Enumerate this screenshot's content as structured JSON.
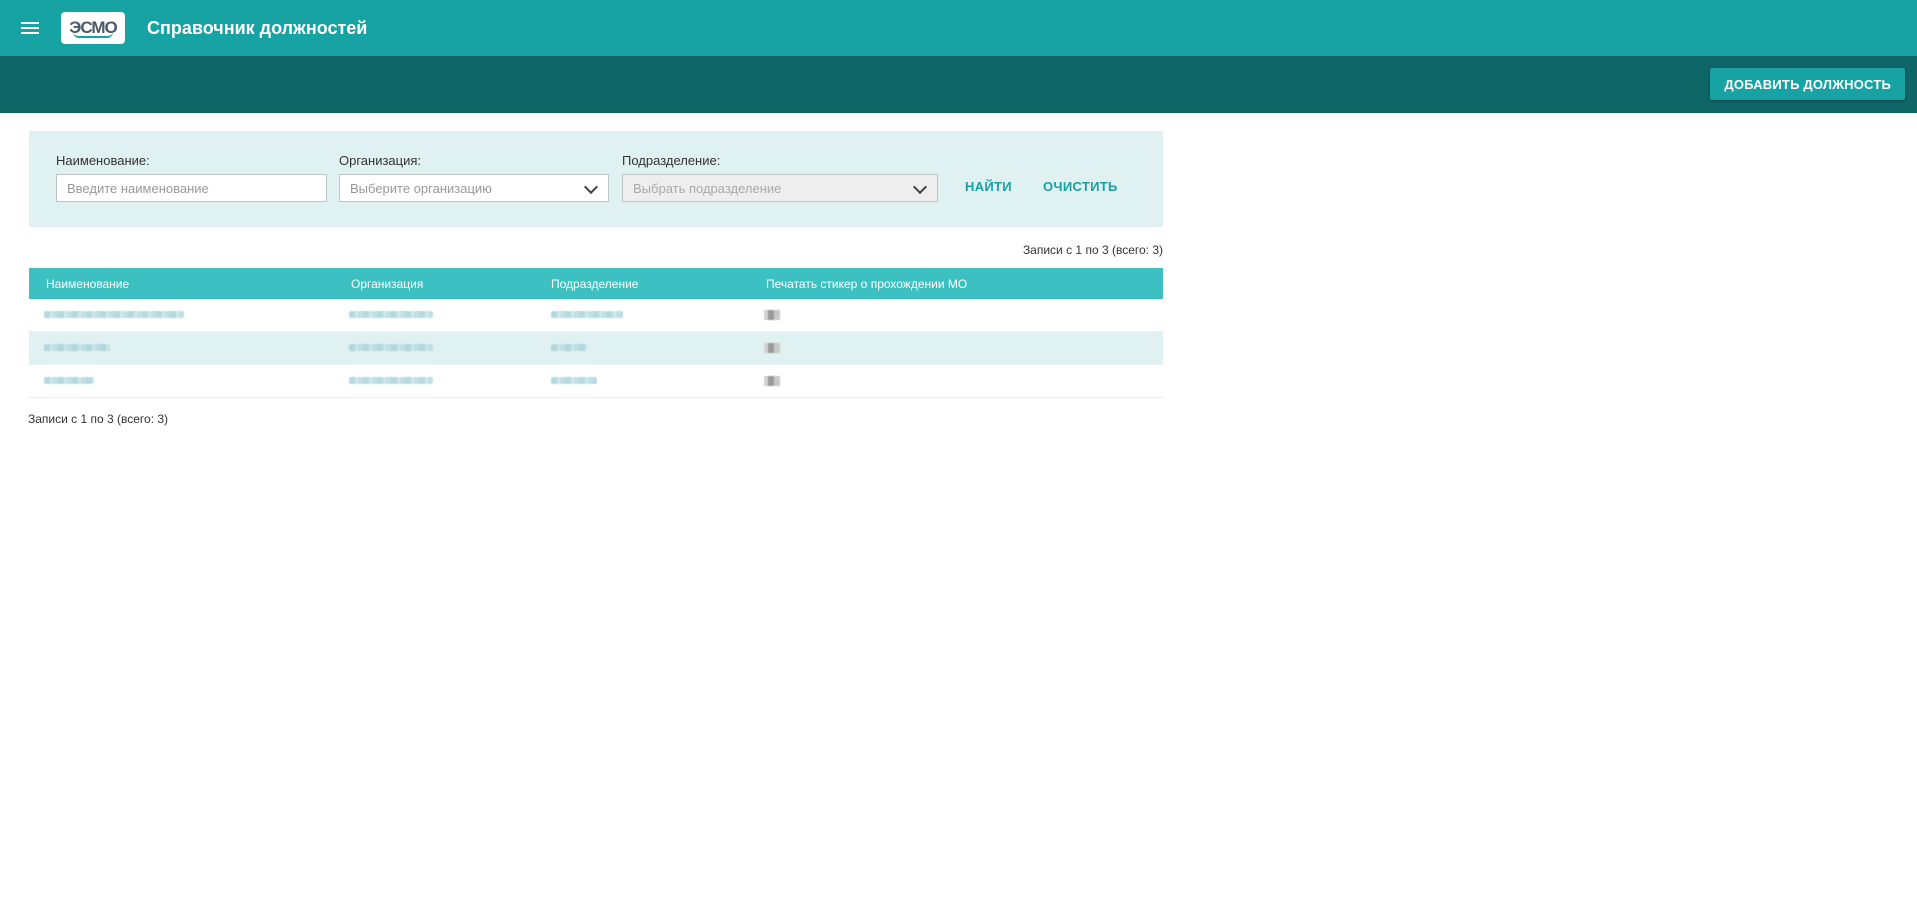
{
  "header": {
    "logo_text": "ЭСМО",
    "title": "Справочник должностей"
  },
  "toolbar": {
    "add_button_label": "ДОБАВИТЬ ДОЛЖНОСТЬ"
  },
  "filters": {
    "name": {
      "label": "Наименование:",
      "placeholder": "Введите наименование",
      "value": ""
    },
    "organization": {
      "label": "Организация:",
      "placeholder": "Выберите организацию"
    },
    "division": {
      "label": "Подразделение:",
      "placeholder": "Выбрать подразделение",
      "disabled": true
    },
    "find_label": "НАЙТИ",
    "clear_label": "ОЧИСТИТЬ"
  },
  "pagination": {
    "summary_top": "Записи с 1 по 3 (всего: 3)",
    "summary_bottom": "Записи с 1 по 3 (всего: 3)"
  },
  "table": {
    "columns": [
      "Наименование",
      "Организация",
      "Подразделение",
      "Печатать стикер о прохождении МО"
    ],
    "rows_note": "cell contents are pixelated/redacted in the screenshot"
  },
  "colors": {
    "primary": "#17a2a3",
    "primary_dark": "#0f6667",
    "table_header": "#3cc0c1",
    "panel_bg": "#dff1f0"
  },
  "icons": {
    "menu": "hamburger-menu-icon",
    "dropdown": "chevron-down-icon"
  }
}
